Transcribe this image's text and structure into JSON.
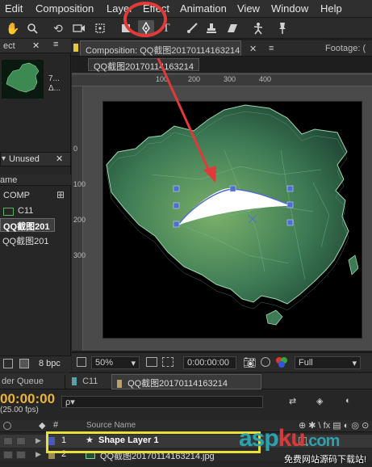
{
  "menubar": {
    "items": [
      "Edit",
      "Composition",
      "Layer",
      "Effect",
      "Animation",
      "View",
      "Window",
      "Help"
    ]
  },
  "toolbar": {
    "tools": [
      "hand-tool",
      "zoom-tool",
      "rotate-tool",
      "camera-tool",
      "pan-tool",
      "rectangle-tool",
      "pen-tool",
      "text-tool",
      "brush-tool",
      "clone-stamp-tool",
      "eraser-tool",
      "puppet-tool",
      "pin-tool"
    ]
  },
  "project": {
    "tab_label": "ect",
    "thumb_info_1": "7...",
    "thumb_info_2": "Δ...",
    "folder_select": "Unused",
    "column_name": "ame",
    "items": [
      {
        "name": "COMP",
        "icon": "folder-icon"
      },
      {
        "name": "C11",
        "icon": "comp-icon"
      },
      {
        "name": "QQ截图201",
        "icon": "image-icon"
      },
      {
        "name": "QQ截图201",
        "icon": "image-icon"
      }
    ],
    "bit_depth": "8 bpc"
  },
  "composition": {
    "tab_label": "Composition: QQ截图20170114163214",
    "footage_tab": "Footage: (",
    "breadcrumb": "QQ截图20170114163214",
    "ruler_top_labels": [
      "100",
      "200",
      "300",
      "400"
    ],
    "ruler_left_labels": [
      "0",
      "100",
      "200",
      "300"
    ],
    "zoom": "50%",
    "timecode": "0:00:00:00",
    "resolution": "Full"
  },
  "timeline": {
    "tabs": [
      {
        "label": "der Queue"
      },
      {
        "label": "C11"
      },
      {
        "label": "QQ截图20170114163214"
      }
    ],
    "current_time": "00:00:00",
    "fps": "(25.00 fps)",
    "search_placeholder": "ρ▾",
    "column_source_name": "Source Name",
    "layers": [
      {
        "index": "1",
        "name": "Shape Layer 1",
        "icon": "star-icon",
        "selected": true
      },
      {
        "index": "2",
        "name": "QQ截图20170114163214.jpg",
        "icon": "image-icon",
        "selected": false
      }
    ]
  },
  "watermark": {
    "logo_part_1": "asp",
    "logo_part_2": "ku",
    "logo_part_3": ".com",
    "tagline": "免费网站源码下载站!"
  },
  "colors": {
    "annotation_red": "#e03a3a",
    "highlight_yellow": "#e8e03a",
    "watermark_teal": "#2aa3b0",
    "watermark_red": "#d83a3a"
  }
}
